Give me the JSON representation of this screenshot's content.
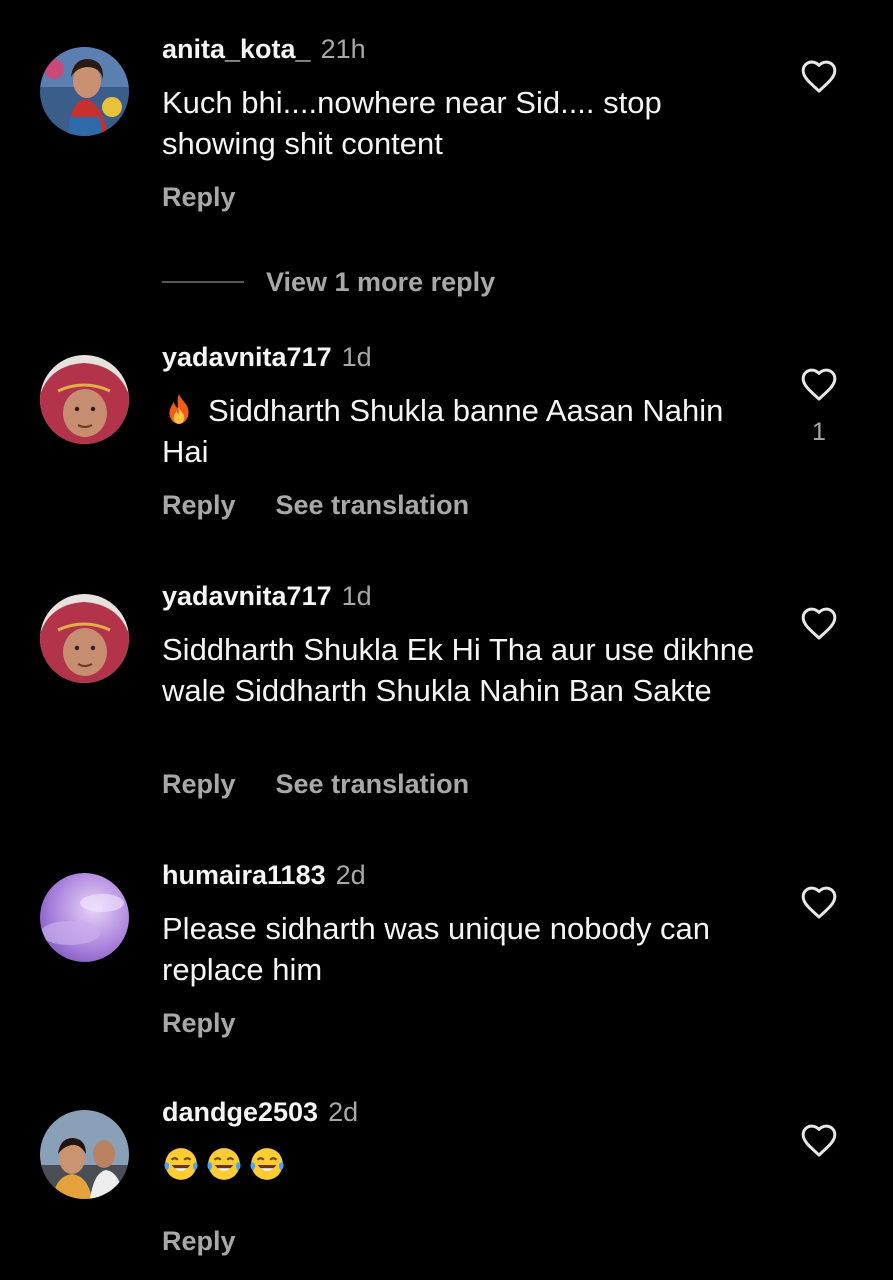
{
  "comments": [
    {
      "username": "anita_kota_",
      "time": "21h",
      "text": "Kuch bhi....nowhere near Sid.... stop showing shit content",
      "reply": "Reply",
      "avatar": "profile-photo-woman-red"
    },
    {
      "username": "yadavnita717",
      "time": "1d",
      "emoji": "fire-emoji",
      "text": "Siddharth Shukla banne Aasan Nahin Hai",
      "reply": "Reply",
      "translate": "See translation",
      "likes": "1",
      "avatar": "profile-photo-woman-headscarf"
    },
    {
      "username": "yadavnita717",
      "time": "1d",
      "text": "Siddharth Shukla Ek Hi Tha aur use dikhne wale Siddharth Shukla Nahin Ban Sakte",
      "reply": "Reply",
      "translate": "See translation",
      "avatar": "profile-photo-woman-headscarf"
    },
    {
      "username": "humaira1183",
      "time": "2d",
      "text": "Please sidharth was unique nobody can replace him",
      "reply": "Reply",
      "avatar": "profile-photo-purple-sky"
    },
    {
      "username": "dandge2503",
      "time": "2d",
      "emojis": [
        "laughing-tears-emoji",
        "laughing-tears-emoji",
        "laughing-tears-emoji"
      ],
      "reply": "Reply",
      "avatar": "profile-photo-couple"
    }
  ],
  "view_more_replies": "View 1 more reply",
  "colors": {
    "background": "#000000",
    "primary_text": "#f5f5f5",
    "secondary_text": "#a8a8a8",
    "divider": "#555555"
  }
}
